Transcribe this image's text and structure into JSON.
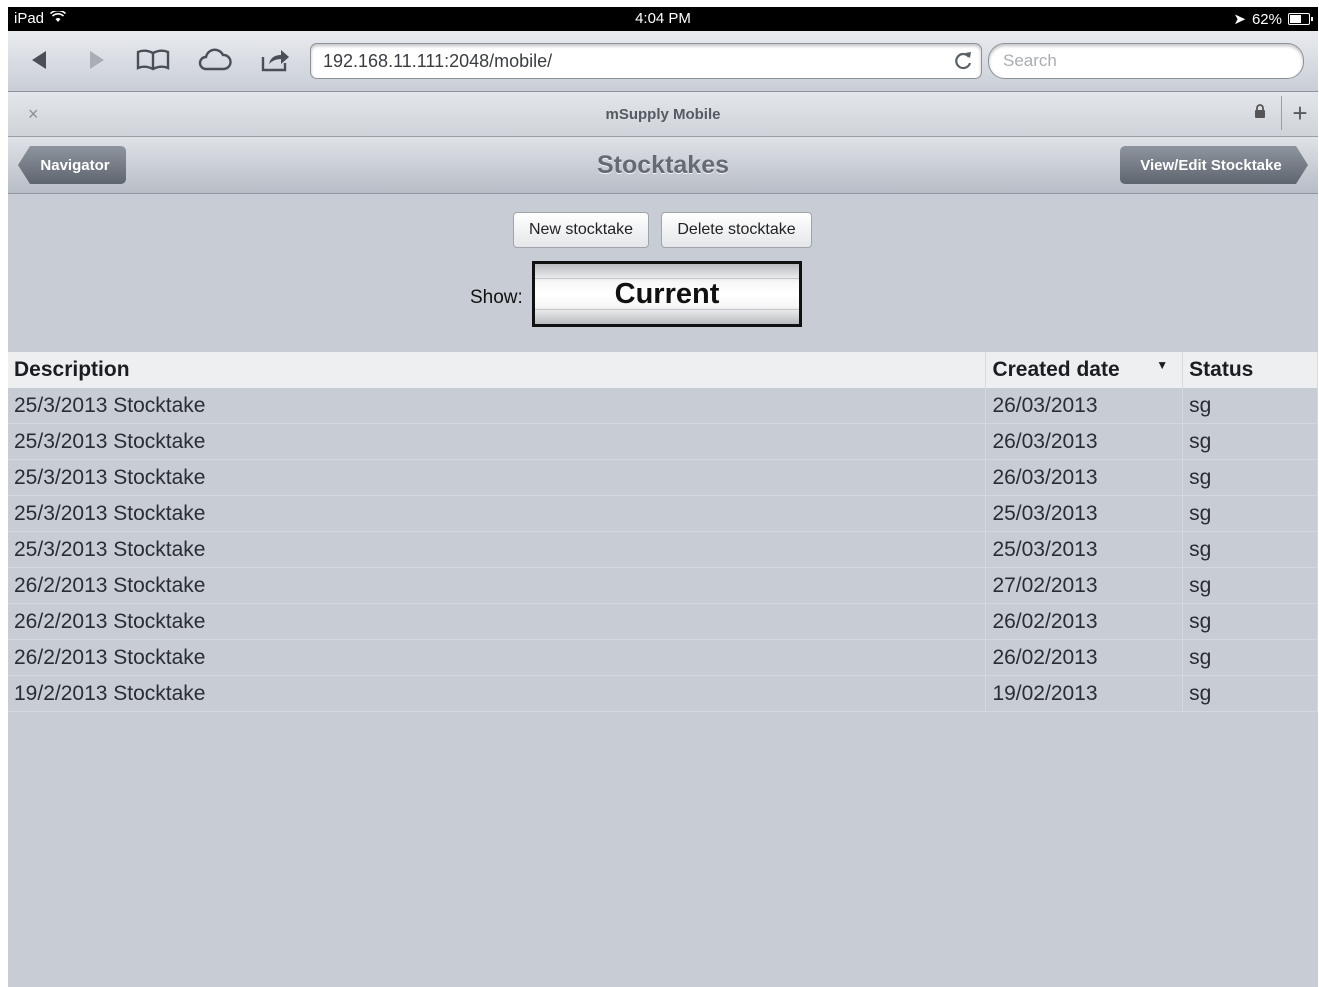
{
  "statusbar": {
    "device": "iPad",
    "time": "4:04 PM",
    "battery": "62%"
  },
  "browser": {
    "url": "192.168.11.111:2048/mobile/",
    "search_placeholder": "Search",
    "tab_title": "mSupply Mobile",
    "tab_close": "×",
    "new_tab": "+"
  },
  "header": {
    "back_label": "Navigator",
    "title": "Stocktakes",
    "forward_label": "View/Edit Stocktake"
  },
  "controls": {
    "new_label": "New stocktake",
    "delete_label": "Delete stocktake",
    "show_label": "Show:",
    "show_value": "Current"
  },
  "table": {
    "headers": {
      "description": "Description",
      "created": "Created date",
      "status": "Status"
    },
    "rows": [
      {
        "description": "25/3/2013 Stocktake",
        "created": "26/03/2013",
        "status": "sg"
      },
      {
        "description": "25/3/2013 Stocktake",
        "created": "26/03/2013",
        "status": "sg"
      },
      {
        "description": "25/3/2013 Stocktake",
        "created": "26/03/2013",
        "status": "sg"
      },
      {
        "description": "25/3/2013 Stocktake",
        "created": "25/03/2013",
        "status": "sg"
      },
      {
        "description": "25/3/2013 Stocktake",
        "created": "25/03/2013",
        "status": "sg"
      },
      {
        "description": "26/2/2013 Stocktake",
        "created": "27/02/2013",
        "status": "sg"
      },
      {
        "description": "26/2/2013 Stocktake",
        "created": "26/02/2013",
        "status": "sg"
      },
      {
        "description": "26/2/2013 Stocktake",
        "created": "26/02/2013",
        "status": "sg"
      },
      {
        "description": "19/2/2013 Stocktake",
        "created": "19/02/2013",
        "status": "sg"
      }
    ]
  }
}
